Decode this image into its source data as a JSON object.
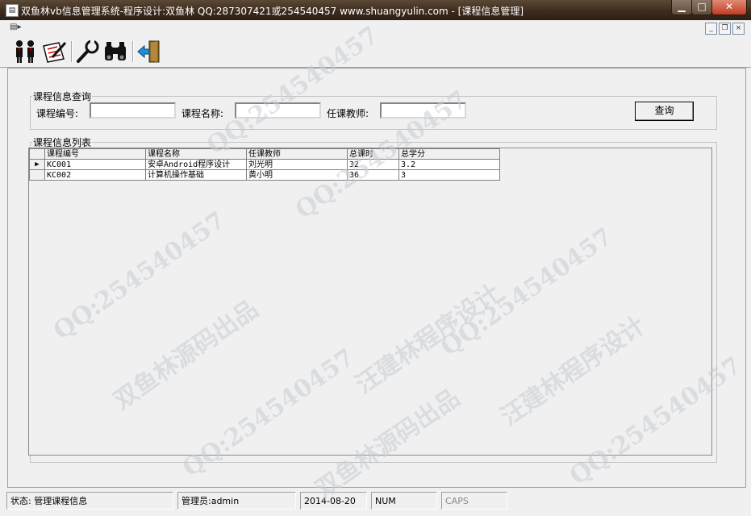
{
  "window": {
    "title": "双鱼林vb信息管理系统-程序设计:双鱼林 QQ:287307421或254540457 www.shuangyulin.com - [课程信息管理]",
    "controls": [
      "minimize-icon",
      "maximize-icon",
      "close-icon"
    ]
  },
  "toolbar": {
    "buttons": [
      {
        "icon": "users-icon"
      },
      {
        "icon": "edit-document-icon"
      },
      {
        "icon": "wrench-icon"
      },
      {
        "icon": "binoculars-icon"
      },
      {
        "icon": "exit-door-icon"
      }
    ]
  },
  "query": {
    "legend": "课程信息查询",
    "course_no_label": "课程编号:",
    "course_no_value": "",
    "course_name_label": "课程名称:",
    "course_name_value": "",
    "teacher_label": "任课教师:",
    "teacher_value": "",
    "search_label": "查询"
  },
  "list": {
    "legend": "课程信息列表",
    "columns": [
      "课程编号",
      "课程名称",
      "任课教师",
      "总课时",
      "总学分"
    ],
    "rows": [
      [
        "KC001",
        "安卓Android程序设计",
        "刘光明",
        "32",
        "3.2"
      ],
      [
        "KC002",
        "计算机操作基础",
        "黄小明",
        "36",
        "3"
      ]
    ],
    "current_row_marker": "▶"
  },
  "status": {
    "state": "状态: 管理课程信息",
    "admin": "管理员:admin",
    "date": "2014-08-20",
    "num": "NUM",
    "caps": "CAPS"
  },
  "watermarks": [
    "QQ:254540457",
    "双鱼林源码出品",
    "汪建林程序设计"
  ]
}
